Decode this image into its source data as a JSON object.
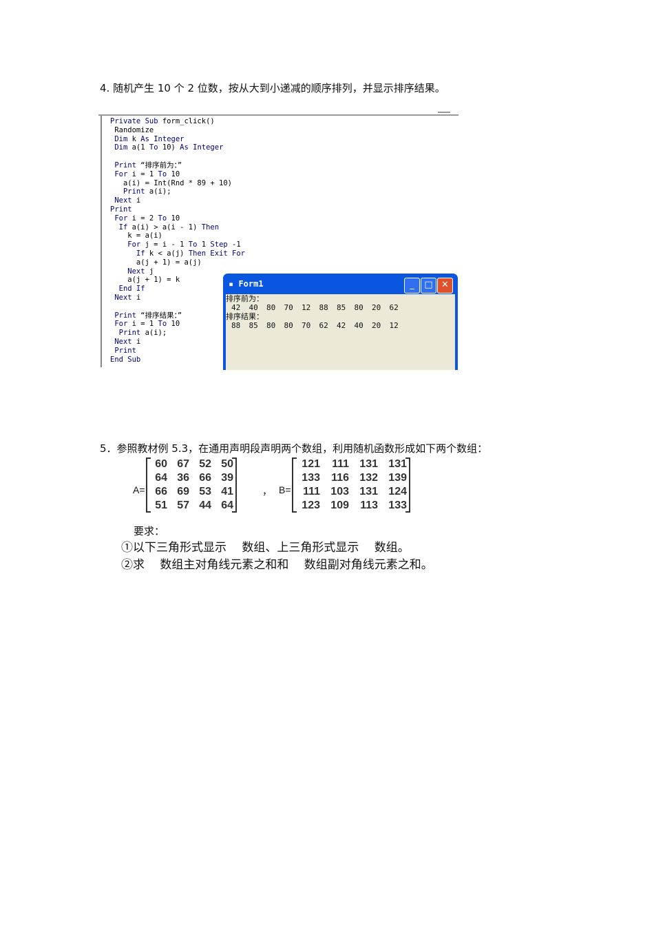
{
  "q4": {
    "title": "4. 随机产生 10 个 2 位数，按从大到小递减的顺序排列，并显示排序结果。"
  },
  "code": [
    [
      {
        "t": "Private Sub ",
        "kw": true
      },
      {
        "t": "form_click()"
      }
    ],
    [
      {
        "t": " Randomize"
      }
    ],
    [
      {
        "t": " Dim ",
        "kw": true
      },
      {
        "t": "k "
      },
      {
        "t": "As Integer",
        "kw": true
      }
    ],
    [
      {
        "t": " Dim ",
        "kw": true
      },
      {
        "t": "a(1 "
      },
      {
        "t": "To",
        "kw": true
      },
      {
        "t": " 10) "
      },
      {
        "t": "As Integer",
        "kw": true
      }
    ],
    [],
    [
      {
        "t": " Print ",
        "kw": true
      },
      {
        "t": "“排序前为：”"
      }
    ],
    [
      {
        "t": " For ",
        "kw": true
      },
      {
        "t": "i = 1 "
      },
      {
        "t": "To",
        "kw": true
      },
      {
        "t": " 10"
      }
    ],
    [
      {
        "t": "   a(i) = Int(Rnd * 89 + 10)"
      }
    ],
    [
      {
        "t": "   Print ",
        "kw": true
      },
      {
        "t": "a(i);"
      }
    ],
    [
      {
        "t": " Next ",
        "kw": true
      },
      {
        "t": "i"
      }
    ],
    [
      {
        "t": "Print",
        "kw": true
      }
    ],
    [
      {
        "t": " For ",
        "kw": true
      },
      {
        "t": "i = 2 "
      },
      {
        "t": "To",
        "kw": true
      },
      {
        "t": " 10"
      }
    ],
    [
      {
        "t": "  If ",
        "kw": true
      },
      {
        "t": "a(i) > a(i - 1) "
      },
      {
        "t": "Then",
        "kw": true
      }
    ],
    [
      {
        "t": "    k = a(i)"
      }
    ],
    [
      {
        "t": "    For ",
        "kw": true
      },
      {
        "t": "j = i - 1 "
      },
      {
        "t": "To",
        "kw": true
      },
      {
        "t": " 1 "
      },
      {
        "t": "Step",
        "kw": true
      },
      {
        "t": " -1"
      }
    ],
    [
      {
        "t": "      If ",
        "kw": true
      },
      {
        "t": "k < a(j) "
      },
      {
        "t": "Then Exit For",
        "kw": true
      }
    ],
    [
      {
        "t": "      a(j + 1) = a(j)"
      }
    ],
    [
      {
        "t": "    Next ",
        "kw": true
      },
      {
        "t": "j"
      }
    ],
    [
      {
        "t": "    a(j + 1) = k"
      }
    ],
    [
      {
        "t": "  End If",
        "kw": true
      }
    ],
    [
      {
        "t": " Next ",
        "kw": true
      },
      {
        "t": "i"
      }
    ],
    [],
    [
      {
        "t": " Print ",
        "kw": true
      },
      {
        "t": "“排序结果：”"
      }
    ],
    [
      {
        "t": " For ",
        "kw": true
      },
      {
        "t": "i = 1 "
      },
      {
        "t": "To",
        "kw": true
      },
      {
        "t": " 10"
      }
    ],
    [
      {
        "t": "  Print ",
        "kw": true
      },
      {
        "t": "a(i);"
      }
    ],
    [
      {
        "t": " Next ",
        "kw": true
      },
      {
        "t": "i"
      }
    ],
    [
      {
        "t": " Print",
        "kw": true
      }
    ],
    [
      {
        "t": "End Sub",
        "kw": true
      }
    ]
  ],
  "form1": {
    "title": "Form1",
    "label_before": "排序前为：",
    "before": [
      "42",
      "40",
      "80",
      "70",
      "12",
      "88",
      "85",
      "80",
      "20",
      "62"
    ],
    "label_after": "排序结果：",
    "after": [
      "88",
      "85",
      "80",
      "80",
      "70",
      "62",
      "42",
      "40",
      "20",
      "12"
    ]
  },
  "q5": {
    "title": "5．参照教材例 5.3，在通用声明段声明两个数组，利用随机函数形成如下两个数组：",
    "a_label": "A=",
    "b_label": "B=",
    "comma": "，",
    "A": [
      [
        "60",
        "67",
        "52",
        "50"
      ],
      [
        "64",
        "36",
        "66",
        "39"
      ],
      [
        "66",
        "69",
        "53",
        "41"
      ],
      [
        "51",
        "57",
        "44",
        "64"
      ]
    ],
    "B": [
      [
        "121",
        "111",
        "131",
        "131"
      ],
      [
        "133",
        "116",
        "132",
        "139"
      ],
      [
        "111",
        "103",
        "131",
        "124"
      ],
      [
        "123",
        "109",
        "113",
        "133"
      ]
    ],
    "req_label": "要求：",
    "req1": "①以下三角形式显示　 数组、上三角形式显示　 数组。",
    "req2": "②求　 数组主对角线元素之和和　 数组副对角线元素之和。"
  }
}
